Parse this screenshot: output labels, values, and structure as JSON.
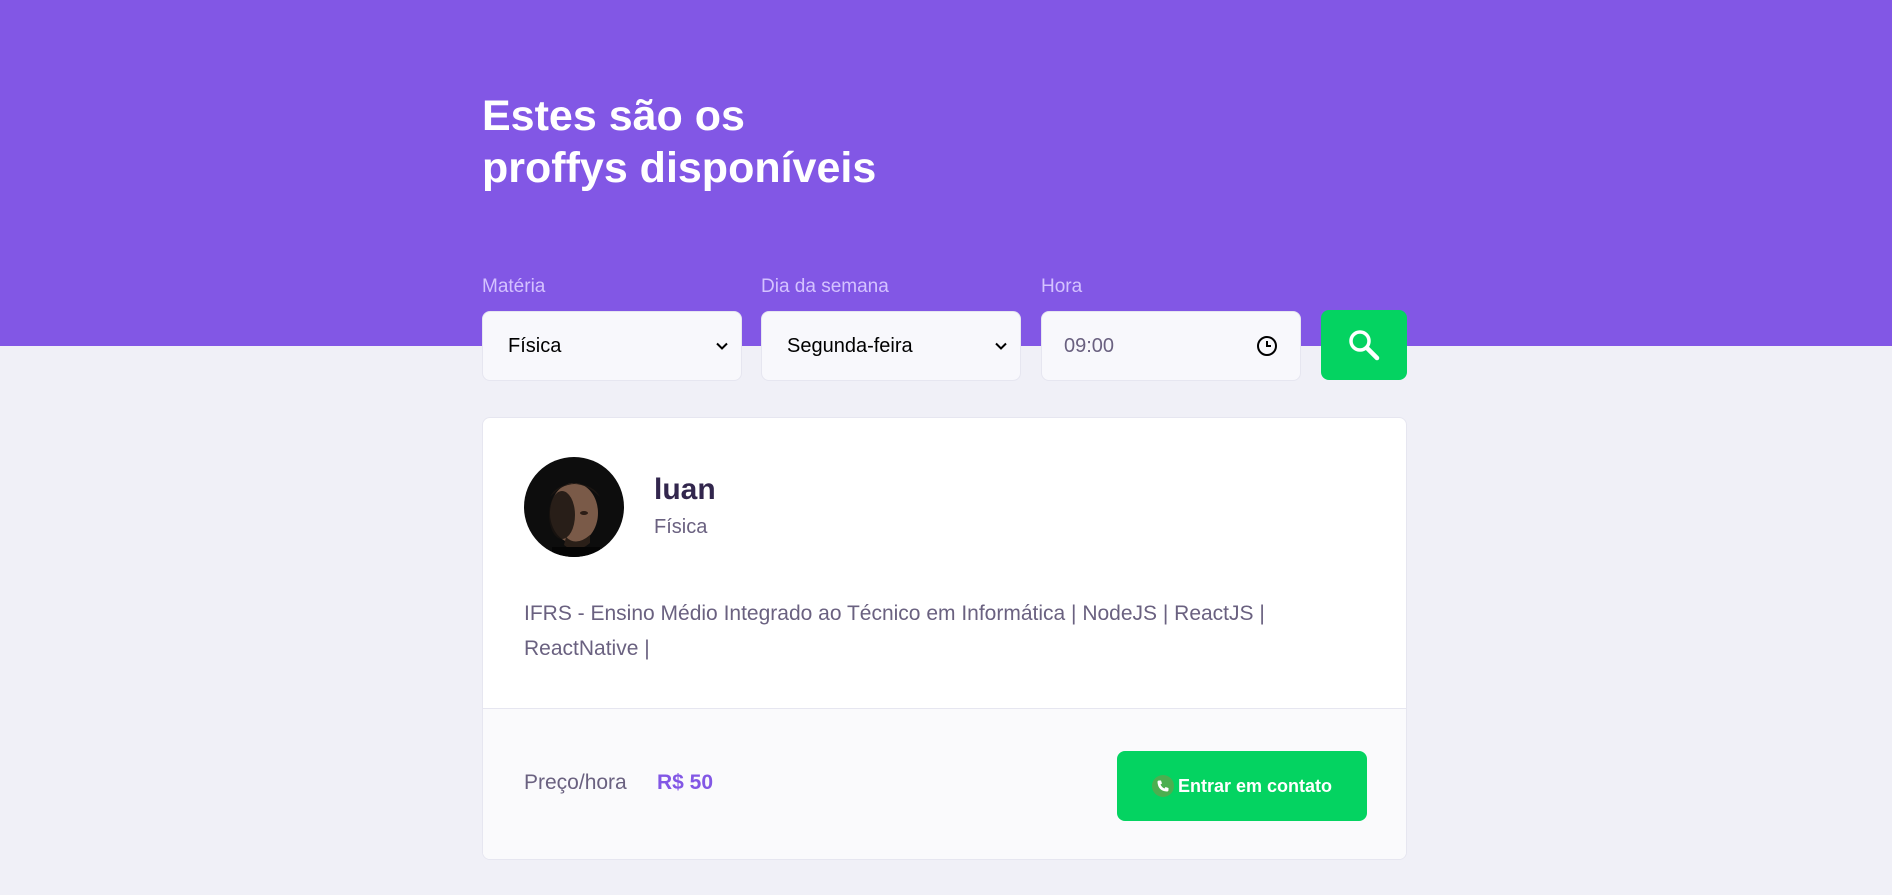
{
  "header": {
    "title_line1": "Estes são os",
    "title_line2": "proffys disponíveis",
    "background_color": "#8257E5"
  },
  "filters": {
    "subject": {
      "label": "Matéria",
      "value": "Física"
    },
    "weekday": {
      "label": "Dia da semana",
      "value": "Segunda-feira"
    },
    "time": {
      "label": "Hora",
      "value": "09:00"
    },
    "search_icon": "search-icon"
  },
  "teacher": {
    "name": "luan",
    "subject": "Física",
    "bio": "IFRS - Ensino Médio Integrado ao Técnico em Informática | NodeJS | ReactJS | ReactNative |",
    "price_label": "Preço/hora",
    "price_value": "R$ 50",
    "contact_label": "Entrar em contato",
    "contact_icon": "whatsapp-phone-icon"
  },
  "colors": {
    "accent": "#8257E5",
    "success": "#04D361",
    "background": "#F0F0F7"
  }
}
